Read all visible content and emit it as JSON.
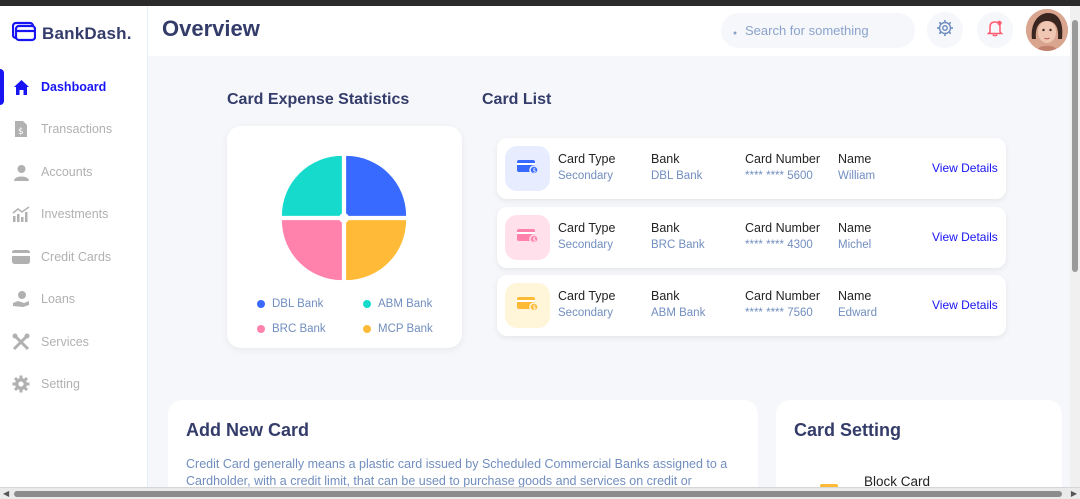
{
  "app": {
    "brand": "BankDash.",
    "page_title": "Overview"
  },
  "sidebar": {
    "items": [
      {
        "label": "Dashboard",
        "icon": "home-icon",
        "active": true
      },
      {
        "label": "Transactions",
        "icon": "transactions-icon",
        "active": false
      },
      {
        "label": "Accounts",
        "icon": "user-icon",
        "active": false
      },
      {
        "label": "Investments",
        "icon": "investments-icon",
        "active": false
      },
      {
        "label": "Credit Cards",
        "icon": "credit-card-icon",
        "active": false
      },
      {
        "label": "Loans",
        "icon": "loans-icon",
        "active": false
      },
      {
        "label": "Services",
        "icon": "services-icon",
        "active": false
      },
      {
        "label": "Setting",
        "icon": "gear-icon",
        "active": false
      }
    ]
  },
  "header": {
    "search_placeholder": "Search for something"
  },
  "expense_stats": {
    "title": "Card Expense Statistics",
    "legend": [
      {
        "label": "DBL Bank",
        "color": "#396aff"
      },
      {
        "label": "ABM Bank",
        "color": "#16dbcc"
      },
      {
        "label": "BRC Bank",
        "color": "#ff82ac"
      },
      {
        "label": "MCP Bank",
        "color": "#ffbb38"
      }
    ]
  },
  "chart_data": {
    "type": "pie",
    "title": "Card Expense Statistics",
    "slices": [
      {
        "label": "DBL Bank",
        "value": 25,
        "color": "#396aff"
      },
      {
        "label": "MCP Bank",
        "value": 25,
        "color": "#ffbb38"
      },
      {
        "label": "BRC Bank",
        "value": 25,
        "color": "#ff82ac"
      },
      {
        "label": "ABM Bank",
        "value": 25,
        "color": "#16dbcc"
      }
    ],
    "legend_position": "bottom"
  },
  "card_list": {
    "title": "Card List",
    "headers": {
      "type": "Card Type",
      "bank": "Bank",
      "number": "Card Number",
      "name": "Name"
    },
    "link_label": "View Details",
    "rows": [
      {
        "type": "Secondary",
        "bank": "DBL Bank",
        "number": "**** **** 5600",
        "name": "William",
        "icon_bg": "#e7edff",
        "icon_color": "#396aff"
      },
      {
        "type": "Secondary",
        "bank": "BRC Bank",
        "number": "**** **** 4300",
        "name": "Michel",
        "icon_bg": "#ffe0eb",
        "icon_color": "#ff82ac"
      },
      {
        "type": "Secondary",
        "bank": "ABM Bank",
        "number": "**** **** 7560",
        "name": "Edward",
        "icon_bg": "#fff5d9",
        "icon_color": "#ffbb38"
      }
    ]
  },
  "add_card": {
    "title": "Add New Card",
    "text": "Credit Card generally means a plastic card issued by Scheduled Commercial Banks assigned to a Cardholder, with a credit limit, that can be used to purchase goods and services on credit or"
  },
  "card_setting": {
    "title": "Card Setting",
    "first_item": "Block Card"
  },
  "colors": {
    "accent": "#1814f3",
    "title": "#343c6a",
    "muted": "#718ebf"
  }
}
